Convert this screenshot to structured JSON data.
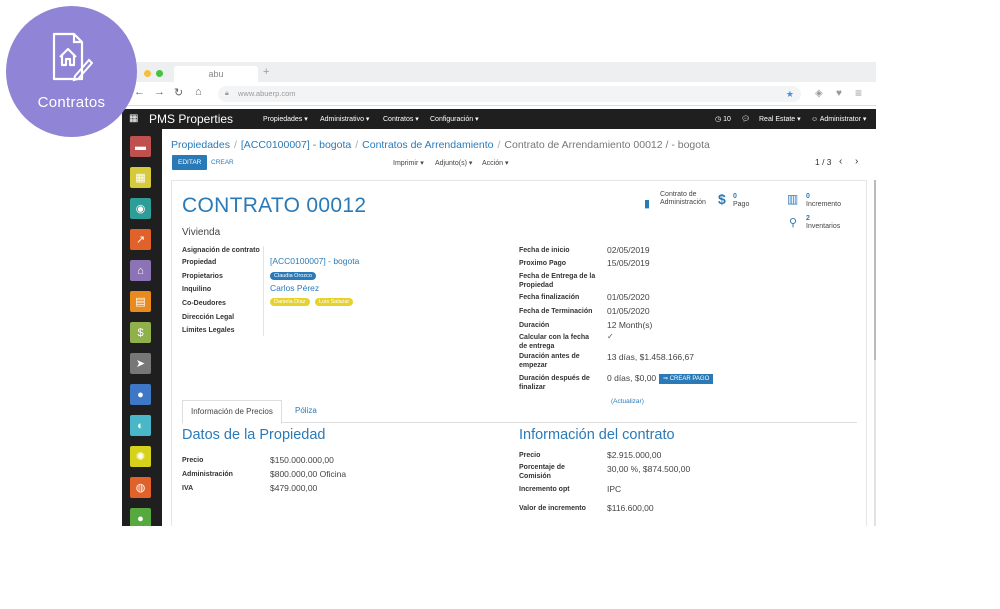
{
  "badge": {
    "label": "Contratos",
    "icon": "contract-house-pen-icon"
  },
  "browser": {
    "tab_title": "abu",
    "url": "www.abuerp.com"
  },
  "topnav": {
    "brand": "PMS Properties",
    "menus": [
      "Propiedades",
      "Administrativo",
      "Contratos",
      "Configuración"
    ],
    "notifications": "10",
    "company": "Real Estate",
    "user": "Administrator"
  },
  "sidebar": {
    "items": [
      {
        "icon": "chat-icon",
        "color": "#c0504d"
      },
      {
        "icon": "calendar-icon",
        "color": "#d6c93a"
      },
      {
        "icon": "contacts-icon",
        "color": "#2e9c97"
      },
      {
        "icon": "chart-up-icon",
        "color": "#e0622a"
      },
      {
        "icon": "buildings-icon",
        "color": "#8b73b5"
      },
      {
        "icon": "document-icon",
        "color": "#e88a1d"
      },
      {
        "icon": "invoice-icon",
        "color": "#8fb04a"
      },
      {
        "icon": "send-icon",
        "color": "#777777"
      },
      {
        "icon": "users-icon",
        "color": "#3e77c6"
      },
      {
        "icon": "user-chat-icon",
        "color": "#49b7c7"
      },
      {
        "icon": "sun-icon",
        "color": "#d6d21b"
      },
      {
        "icon": "globe-icon",
        "color": "#e0622a"
      },
      {
        "icon": "person-icon",
        "color": "#57a83e"
      }
    ]
  },
  "breadcrumb": {
    "items": [
      "Propiedades",
      "[ACC0100007] - bogota",
      "Contratos de Arrendamiento"
    ],
    "current": "Contrato de Arrendamiento 00012 / - bogota"
  },
  "toolbar": {
    "edit": "EDITAR",
    "create": "CREAR",
    "print": "Imprimir",
    "attach": "Adjunto(s)",
    "action": "Acción",
    "pager": "1 / 3"
  },
  "smart_buttons": {
    "contrato": "Contrato de Administración",
    "pago_count": "0",
    "pago_label": "Pago",
    "incremento_count": "0",
    "incremento_label": "Incremento",
    "inventarios_count": "2",
    "inventarios_label": "Inventarios"
  },
  "record": {
    "title": "CONTRATO 00012",
    "subtitle": "Vivienda",
    "left_fields": {
      "asignacion_label": "Asignación de contrato",
      "propiedad_label": "Propiedad",
      "propiedad_value": "[ACC0100007] - bogota",
      "propietarios_label": "Propietarios",
      "propietarios_tags": [
        "Claudia Orozco"
      ],
      "inquilino_label": "Inquilino",
      "inquilino_value": "Carlos Pérez",
      "codeudores_label": "Co-Deudores",
      "codeudores_tags": [
        "Daniela Díaz",
        "Luis Salazar"
      ],
      "direccion_label": "Dirección Legal",
      "limites_label": "Límites Legales"
    },
    "right_fields": {
      "inicio_label": "Fecha de inicio",
      "inicio_value": "02/05/2019",
      "proximo_label": "Proximo Pago",
      "proximo_value": "15/05/2019",
      "entrega_label": "Fecha de Entrega de la Propiedad",
      "finalizacion_label": "Fecha finalización",
      "finalizacion_value": "01/05/2020",
      "terminacion_label": "Fecha de Terminación",
      "terminacion_value": "01/05/2020",
      "duracion_label": "Duración",
      "duracion_value": "12 Month(s)",
      "calcular_label": "Calcular con la fecha de entrega",
      "calcular_value": "✓",
      "antes_label": "Duración antes de empezar",
      "antes_value": "13 días,  $1.458.166,67",
      "despues_label": "Duración después de finalizar",
      "despues_value": "0 días,  $0,00",
      "crear_pago": "⇒ CREAR PAGO",
      "actualizar": "(Actualizar)"
    }
  },
  "tabs": [
    "Información de Precios",
    "Póliza"
  ],
  "precios": {
    "datos_title": "Datos de la Propiedad",
    "precio_label": "Precio",
    "precio_value": "$150.000.000,00",
    "admin_label": "Administración",
    "admin_value": "$800.000,00  Oficina",
    "iva_label": "IVA",
    "iva_value": "$479.000,00",
    "info_title": "Información del contrato",
    "c_precio_label": "Precio",
    "c_precio_value": "$2.915.000,00",
    "comision_label": "Porcentaje de Comisión",
    "comision_value": "30,00 %,  $874.500,00",
    "incremento_label": "Incremento opt",
    "incremento_value": "IPC",
    "valor_inc_label": "Valor de incremento",
    "valor_inc_value": "$116.600,00"
  }
}
